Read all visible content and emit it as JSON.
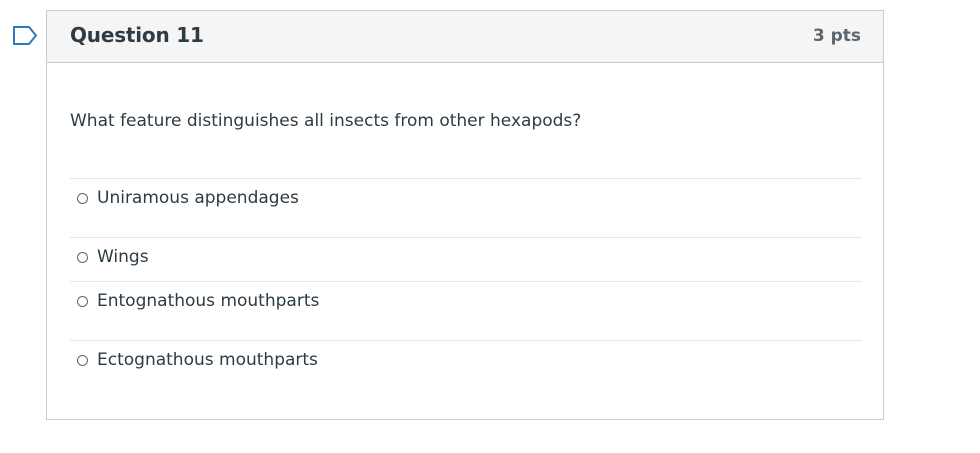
{
  "question": {
    "title": "Question 11",
    "points": "3 pts",
    "text": "What feature distinguishes all insects from other hexapods?",
    "answers": [
      {
        "label": "Uniramous appendages"
      },
      {
        "label": "Wings"
      },
      {
        "label": "Entognathous mouthparts"
      },
      {
        "label": "Ectognathous mouthparts"
      }
    ]
  },
  "icons": {
    "flag": "flag-bookmark-icon",
    "radio": "radio-unchecked-icon"
  },
  "colors": {
    "accent": "#2b7abc",
    "header_bg": "#f5f5f5",
    "border": "#c7cdd1",
    "text": "#2d3b45"
  }
}
